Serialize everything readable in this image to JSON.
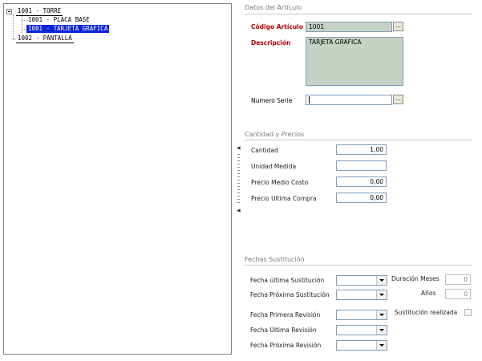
{
  "tree": {
    "nodes": [
      {
        "label": "1001 - TORRE"
      },
      {
        "label": "1001 - PLACA BASE"
      },
      {
        "label": "1001 - TARJETA GRAFICA"
      },
      {
        "label": "1002 - PANTALLA"
      }
    ]
  },
  "datos": {
    "section_title": "Datos del Artículo",
    "codigo_label": "Código Artículo",
    "codigo_value": "1001",
    "descripcion_label": "Descripción",
    "descripcion_value": "TARJETA GRAFICA",
    "numero_serie_label": "Numero Serie",
    "numero_serie_value": "",
    "ellipsis": "..."
  },
  "cantidad": {
    "section_title": "Cantidad y Precios",
    "cantidad_label": "Cantidad",
    "cantidad_value": "1,00",
    "unidad_label": "Unidad Medida",
    "unidad_value": "",
    "precio_medio_label": "Precio Medio Costo",
    "precio_medio_value": "0,00",
    "precio_ultima_label": "Precio Ultima Compra",
    "precio_ultima_value": "0,00"
  },
  "fechas": {
    "section_title": "Fechas Sustitución",
    "ultima_sust_label": "Fecha última Sustitución",
    "proxima_sust_label": "Fecha Próxima Sustitución",
    "primera_rev_label": "Fecha Primera Revisión",
    "ultima_rev_label": "Fecha Última Revisión",
    "proxima_rev_label": "Fecha Próxima Revisión",
    "duracion_label": "Duración Meses",
    "duracion_value": "0",
    "anos_label": "Años",
    "anos_value": "0",
    "sustitucion_label": "Sustitución realizada"
  }
}
